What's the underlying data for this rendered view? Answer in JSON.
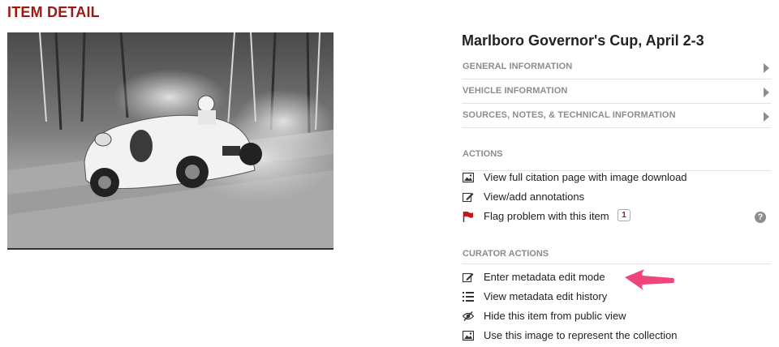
{
  "page": {
    "title": "ITEM DETAIL"
  },
  "item": {
    "title": "Marlboro Governor's Cup, April 2-3"
  },
  "info_sections": [
    {
      "label": "GENERAL INFORMATION",
      "icon": "chevron-right-icon"
    },
    {
      "label": "VEHICLE INFORMATION",
      "icon": "chevron-right-icon"
    },
    {
      "label": "SOURCES, NOTES, & TECHNICAL INFORMATION",
      "icon": "chevron-right-icon"
    }
  ],
  "actions": {
    "heading": "ACTIONS",
    "items": [
      {
        "label": "View full citation page with image download",
        "icon": "image-icon"
      },
      {
        "label": "View/add annotations",
        "icon": "pencil-icon"
      },
      {
        "label": "Flag problem with this item",
        "icon": "flag-icon",
        "badge": "1"
      }
    ],
    "help_icon": "?"
  },
  "curator_actions": {
    "heading": "CURATOR ACTIONS",
    "items": [
      {
        "label": "Enter metadata edit mode",
        "icon": "pencil-icon"
      },
      {
        "label": "View metadata edit history",
        "icon": "list-icon"
      },
      {
        "label": "Hide this item from public view",
        "icon": "eye-slash-icon"
      },
      {
        "label": "Use this image to represent the collection",
        "icon": "image-icon"
      }
    ]
  },
  "colors": {
    "title_red": "#9b1a12",
    "section_gray": "#8c8c8c",
    "annotation_arrow": "#f0457a",
    "flag_red": "#c8161d"
  }
}
